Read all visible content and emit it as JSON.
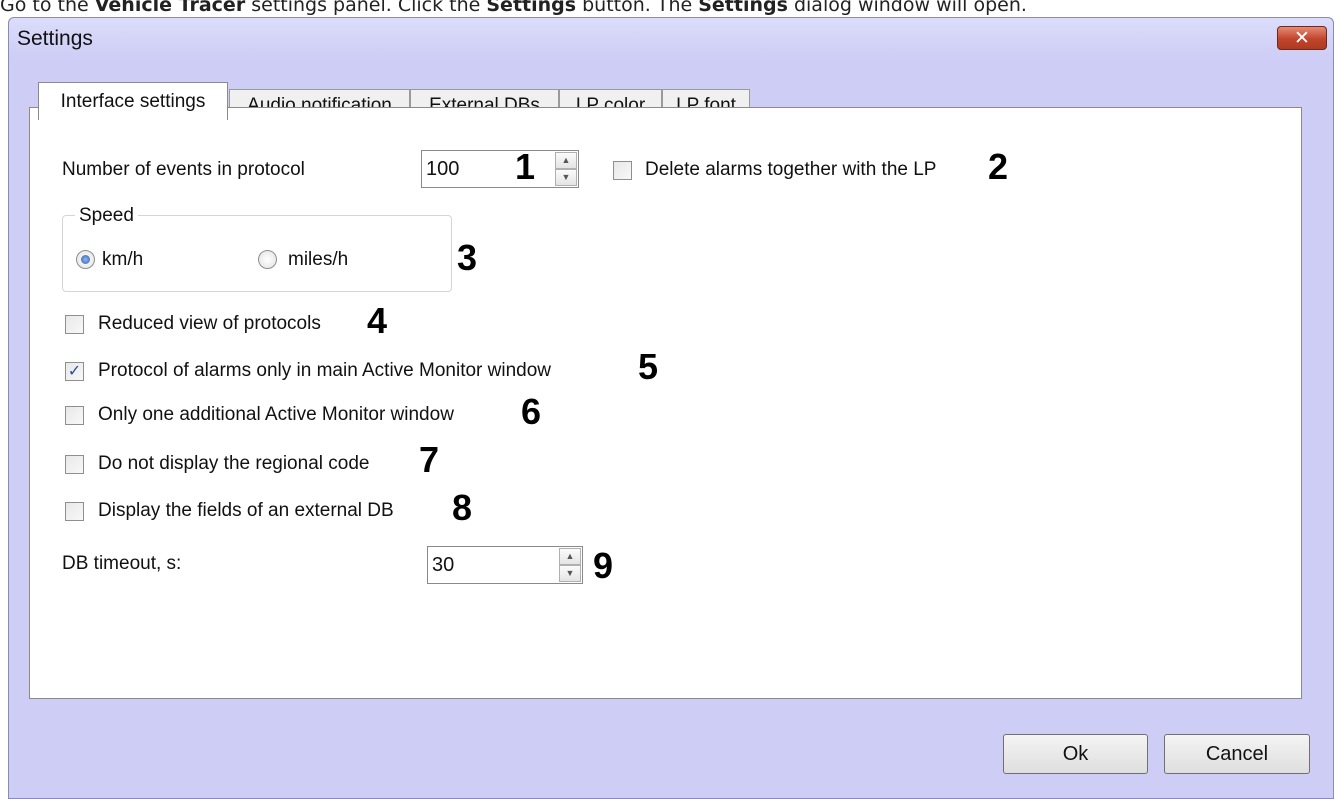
{
  "instruction": {
    "p1": "Go to the ",
    "b1": "Vehicle Tracer",
    "p2": " settings panel. Click the ",
    "b2": "Settings",
    "p3": " button. The ",
    "b3": "Settings",
    "p4": " dialog window will open."
  },
  "window": {
    "title": "Settings",
    "close_glyph": "✕"
  },
  "tabs": [
    {
      "label": "Interface settings",
      "active": true
    },
    {
      "label": "Audio notification",
      "active": false
    },
    {
      "label": "External DBs",
      "active": false
    },
    {
      "label": "LP color",
      "active": false
    },
    {
      "label": "LP font",
      "active": false
    }
  ],
  "settings": {
    "events_label": "Number of events in protocol",
    "events_value": "100",
    "delete_alarms_label": "Delete alarms together with the LP",
    "delete_alarms_checked": false,
    "speed_group_title": "Speed",
    "speed_kmh": "km/h",
    "speed_mph": "miles/h",
    "speed_selected": "km/h",
    "reduced_view_label": "Reduced view of protocols",
    "reduced_view_checked": false,
    "alarms_main_label": "Protocol of alarms only in main Active Monitor window",
    "alarms_main_checked": true,
    "one_window_label": "Only one additional Active Monitor window",
    "one_window_checked": false,
    "no_regional_label": "Do not display the regional code",
    "no_regional_checked": false,
    "ext_db_fields_label": "Display the fields of an external DB",
    "ext_db_fields_checked": false,
    "db_timeout_label": "DB timeout, s:",
    "db_timeout_value": "30",
    "spin_up": "▲",
    "spin_down": "▼",
    "check_glyph": "✓"
  },
  "callouts": [
    "1",
    "2",
    "3",
    "4",
    "5",
    "6",
    "7",
    "8",
    "9"
  ],
  "buttons": {
    "ok": "Ok",
    "cancel": "Cancel"
  }
}
